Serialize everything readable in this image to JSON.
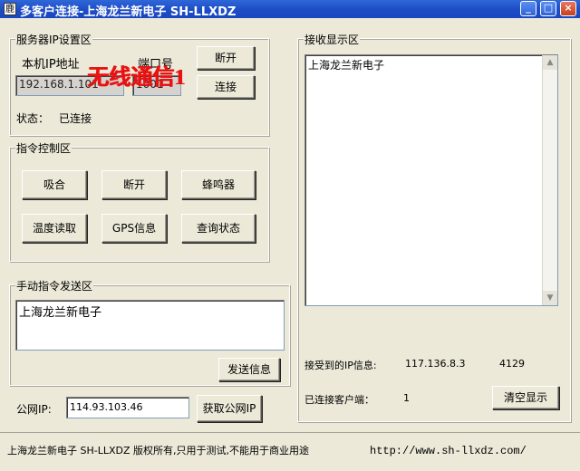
{
  "window": {
    "icon": "app-icon",
    "icon_glyph": "鹿",
    "title": "多客户连接-上海龙兰新电子 SH-LLXDZ",
    "controls": {
      "minimize": "_",
      "maximize": "□",
      "close": "×"
    }
  },
  "server_group": {
    "legend": "服务器IP设置区",
    "local_ip_label": "本机IP地址",
    "port_label": "端口号",
    "ip_value": "192.168.1.101",
    "port_value": "1001",
    "disconnect_button": "断开",
    "connect_button": "连接",
    "status_label": "状态：",
    "status_value": "已连接",
    "overlay_text": "无线通信1"
  },
  "command_group": {
    "legend": "指令控制区",
    "buttons": [
      "吸合",
      "断开",
      "蜂鸣器",
      "温度读取",
      "GPS信息",
      "查询状态"
    ]
  },
  "manual_group": {
    "legend": "手动指令发送区",
    "text": "上海龙兰新电子",
    "send_button": "发送信息"
  },
  "public_ip": {
    "label": "公网IP:",
    "value": "114.93.103.46",
    "button": "获取公网IP"
  },
  "receive_group": {
    "legend": "接收显示区",
    "text": "上海龙兰新电子",
    "received_ip_label": "接受到的IP信息:",
    "received_ip": "117.136.8.3",
    "received_port": "4129",
    "clients_label": "已连接客户端：",
    "clients_count": "1",
    "clear_button": "清空显示"
  },
  "footer": {
    "copyright": "上海龙兰新电子 SH-LLXDZ 版权所有,只用于测试,不能用于商业用途",
    "url": "http://www.sh-llxdz.com/"
  }
}
